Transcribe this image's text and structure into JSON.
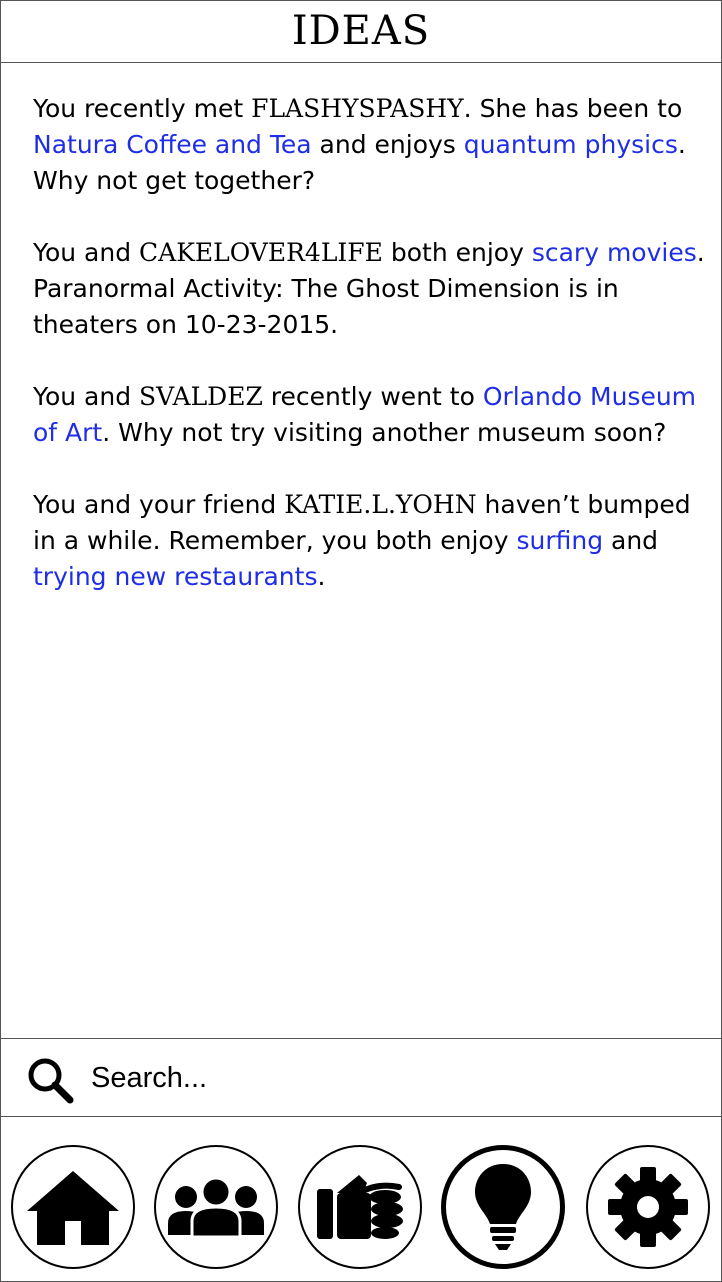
{
  "header": {
    "title": "IDEAS"
  },
  "ideas": [
    {
      "t1": "You recently met ",
      "user": "FLASHYSPASHY",
      "t2": ". She has been to ",
      "link1": "Natura Coffee and Tea",
      "t3": " and enjoys ",
      "link2": "quantum physics",
      "t4": ". Why not get together?"
    },
    {
      "t1": "You and ",
      "user": "CAKELOVER4LIFE",
      "t2": " both enjoy ",
      "link1": "scary movies",
      "t3": ". Paranormal Activity: The Ghost Dimension is in theaters on 10-23-2015."
    },
    {
      "t1": "You and ",
      "user": "SVALDEZ",
      "t2": " recently went to ",
      "link1": "Orlando Museum of Art",
      "t3": ".  Why not try visiting another museum soon?"
    },
    {
      "t1": "You and your friend ",
      "user": "KATIE.L.YOHN",
      "t2": " haven’t bumped in a while. Remember, you both enjoy ",
      "link1": "surfing",
      "t3": " and ",
      "link2": "trying new restaurants",
      "t4": "."
    }
  ],
  "search": {
    "placeholder": "Search...",
    "value": ""
  },
  "nav": {
    "items": [
      {
        "name": "home",
        "icon": "home-icon"
      },
      {
        "name": "friends",
        "icon": "people-icon"
      },
      {
        "name": "bump",
        "icon": "fist-bump-icon"
      },
      {
        "name": "ideas",
        "icon": "lightbulb-icon",
        "active": true
      },
      {
        "name": "settings",
        "icon": "gear-icon"
      }
    ]
  },
  "colors": {
    "link": "#1f2ee6",
    "text": "#000000",
    "border": "#555555"
  }
}
